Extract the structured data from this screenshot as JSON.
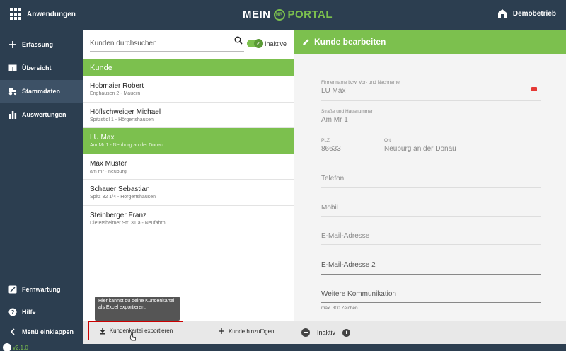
{
  "topbar": {
    "apps_label": "Anwendungen",
    "logo_left": "MEIN",
    "logo_badge": "MR",
    "logo_right": "PORTAL",
    "account_label": "Demobetrieb"
  },
  "sidebar": {
    "items": [
      {
        "label": "Erfassung",
        "icon": "plus-icon"
      },
      {
        "label": "Übersicht",
        "icon": "table-icon"
      },
      {
        "label": "Stammdaten",
        "icon": "tractor-icon"
      },
      {
        "label": "Auswertungen",
        "icon": "bar-chart-icon"
      }
    ],
    "bottom_items": [
      {
        "label": "Fernwartung",
        "icon": "remote-icon"
      },
      {
        "label": "Hilfe",
        "icon": "help-icon"
      },
      {
        "label": "Menü einklappen",
        "icon": "chevron-left-icon"
      }
    ],
    "version": "v2.1.0"
  },
  "list": {
    "search_placeholder": "Kunden durchsuchen",
    "toggle_label": "Inaktive",
    "header": "Kunde",
    "customers": [
      {
        "name": "Hobmaier Robert",
        "address": "Enghausen 2 - Mauern"
      },
      {
        "name": "Höflschweiger Michael",
        "address": "Spitzstidl 1 - Hörgertshausen"
      },
      {
        "name": "LU Max",
        "address": "Am Mr 1 - Neuburg an der Donau"
      },
      {
        "name": "Max Muster",
        "address": "am mr - neuburg"
      },
      {
        "name": "Schauer Sebastian",
        "address": "Spitz 32 1/4 - Hörgertshausen"
      },
      {
        "name": "Steinberger Franz",
        "address": "Dietersheimer Str. 31 a - Neufahrn"
      }
    ],
    "tooltip": "Hier kannst du deine Kundenkartei als Excel exportieren.",
    "export_label": "Kundenkartei exportieren",
    "add_label": "Kunde hinzufügen"
  },
  "edit": {
    "title": "Kunde bearbeiten",
    "name_label": "Firmenname bzw. Vor- und Nachname",
    "name_value": "LU Max",
    "street_label": "Straße und Hausnummer",
    "street_value": "Am Mr 1",
    "zip_label": "PLZ",
    "zip_value": "86633",
    "city_label": "Ort",
    "city_value": "Neuburg an der Donau",
    "phone_placeholder": "Telefon",
    "mobile_placeholder": "Mobil",
    "email_placeholder": "E-Mail-Adresse",
    "email2_placeholder": "E-Mail-Adresse 2",
    "comm_placeholder": "Weitere Kommunikation",
    "comm_hint": "max. 300 Zeichen",
    "inactive_label": "Inaktiv"
  },
  "colors": {
    "accent_green": "#7cc04e",
    "navy": "#2c3e50",
    "export_border": "#cc0000"
  }
}
